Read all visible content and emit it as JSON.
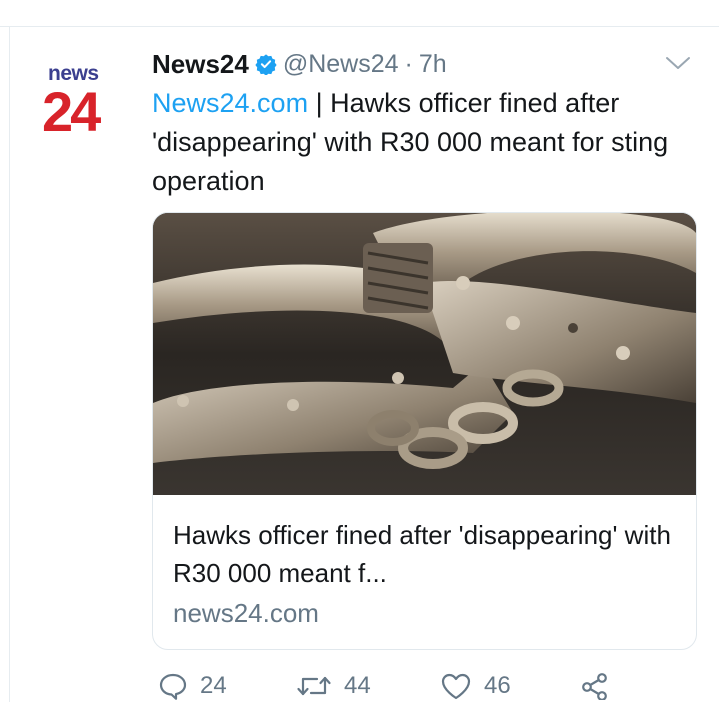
{
  "tweet": {
    "author_name": "News24",
    "handle": "@News24",
    "separator": "·",
    "time": "7h",
    "text_link": "News24.com",
    "text_body": " | Hawks officer fined after 'disappearing' with R30 000 meant for sting operation",
    "avatar": {
      "word": "news",
      "number": "24"
    }
  },
  "card": {
    "title": "Hawks officer fined after 'disappearing' with R30 000 meant f...",
    "domain": "news24.com",
    "image_subject": "handcuffs"
  },
  "actions": {
    "reply_count": "24",
    "retweet_count": "44",
    "like_count": "46"
  },
  "colors": {
    "accent": "#1da1f2",
    "muted": "#657786",
    "text": "#14171a",
    "avatar_red": "#d8232a",
    "avatar_blue": "#3b3f8f"
  },
  "icons": [
    "verified-badge-icon",
    "chevron-down-icon",
    "reply-icon",
    "retweet-icon",
    "like-icon",
    "share-icon"
  ]
}
